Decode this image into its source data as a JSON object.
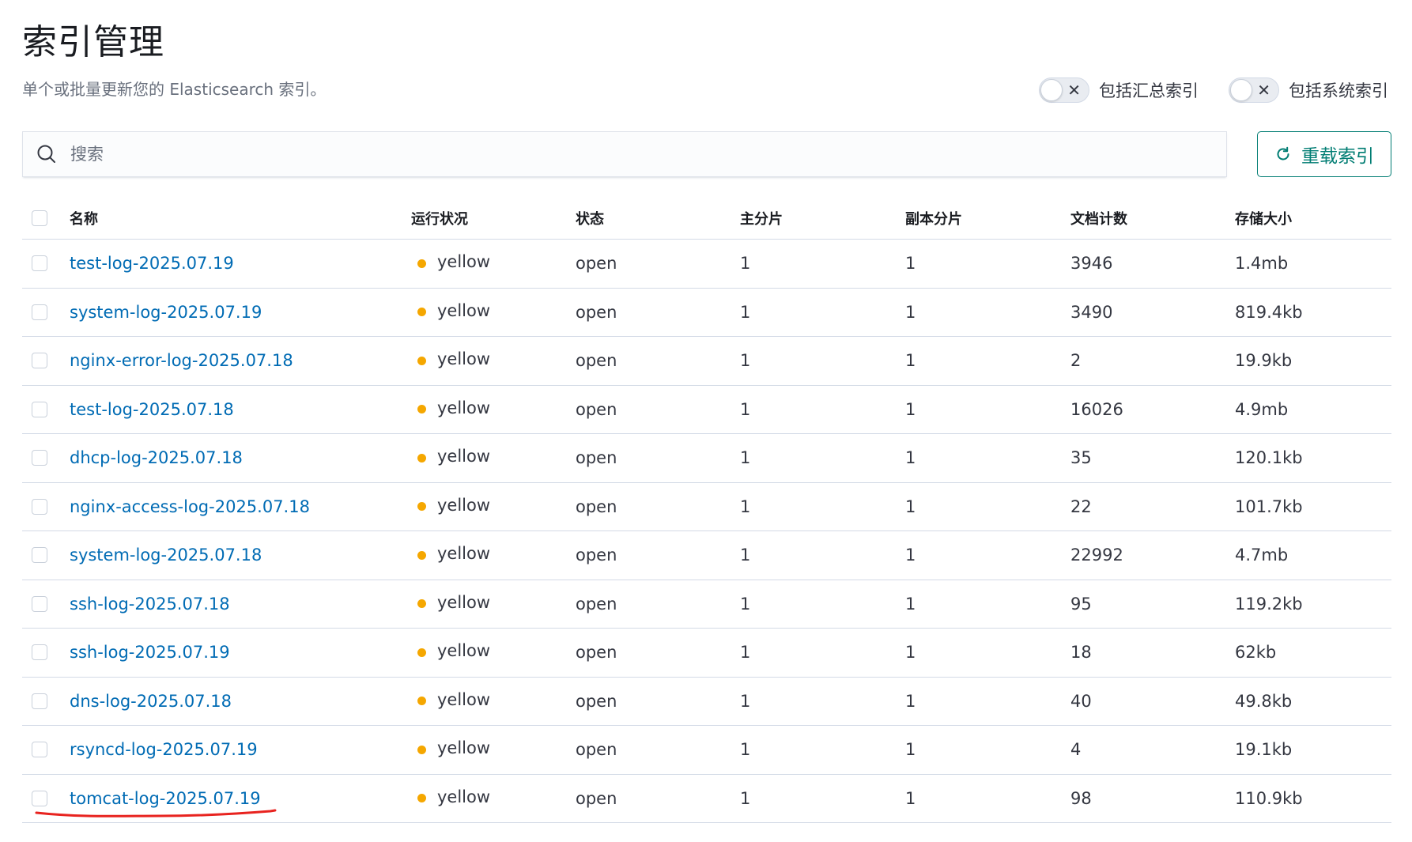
{
  "header": {
    "title": "索引管理",
    "description": "单个或批量更新您的 Elasticsearch 索引。"
  },
  "toggles": {
    "rollup_label": "包括汇总索引",
    "system_label": "包括系统索引",
    "off_glyph": "✕"
  },
  "search": {
    "placeholder": "搜索",
    "value": ""
  },
  "reload_button": {
    "label": "重载索引",
    "icon": "refresh-icon"
  },
  "table": {
    "columns": [
      "名称",
      "运行状况",
      "状态",
      "主分片",
      "副本分片",
      "文档计数",
      "存储大小"
    ],
    "rows": [
      {
        "name": "test-log-2025.07.19",
        "health": "yellow",
        "status": "open",
        "primary": "1",
        "replicas": "1",
        "docs": "3946",
        "size": "1.4mb"
      },
      {
        "name": "system-log-2025.07.19",
        "health": "yellow",
        "status": "open",
        "primary": "1",
        "replicas": "1",
        "docs": "3490",
        "size": "819.4kb"
      },
      {
        "name": "nginx-error-log-2025.07.18",
        "health": "yellow",
        "status": "open",
        "primary": "1",
        "replicas": "1",
        "docs": "2",
        "size": "19.9kb"
      },
      {
        "name": "test-log-2025.07.18",
        "health": "yellow",
        "status": "open",
        "primary": "1",
        "replicas": "1",
        "docs": "16026",
        "size": "4.9mb"
      },
      {
        "name": "dhcp-log-2025.07.18",
        "health": "yellow",
        "status": "open",
        "primary": "1",
        "replicas": "1",
        "docs": "35",
        "size": "120.1kb"
      },
      {
        "name": "nginx-access-log-2025.07.18",
        "health": "yellow",
        "status": "open",
        "primary": "1",
        "replicas": "1",
        "docs": "22",
        "size": "101.7kb"
      },
      {
        "name": "system-log-2025.07.18",
        "health": "yellow",
        "status": "open",
        "primary": "1",
        "replicas": "1",
        "docs": "22992",
        "size": "4.7mb"
      },
      {
        "name": "ssh-log-2025.07.18",
        "health": "yellow",
        "status": "open",
        "primary": "1",
        "replicas": "1",
        "docs": "95",
        "size": "119.2kb"
      },
      {
        "name": "ssh-log-2025.07.19",
        "health": "yellow",
        "status": "open",
        "primary": "1",
        "replicas": "1",
        "docs": "18",
        "size": "62kb"
      },
      {
        "name": "dns-log-2025.07.18",
        "health": "yellow",
        "status": "open",
        "primary": "1",
        "replicas": "1",
        "docs": "40",
        "size": "49.8kb"
      },
      {
        "name": "rsyncd-log-2025.07.19",
        "health": "yellow",
        "status": "open",
        "primary": "1",
        "replicas": "1",
        "docs": "4",
        "size": "19.1kb"
      },
      {
        "name": "tomcat-log-2025.07.19",
        "health": "yellow",
        "status": "open",
        "primary": "1",
        "replicas": "1",
        "docs": "98",
        "size": "110.9kb"
      }
    ]
  },
  "colors": {
    "link": "#006bb4",
    "health_yellow": "#f5a700",
    "accent": "#017d73",
    "annotation": "#e8231f"
  }
}
